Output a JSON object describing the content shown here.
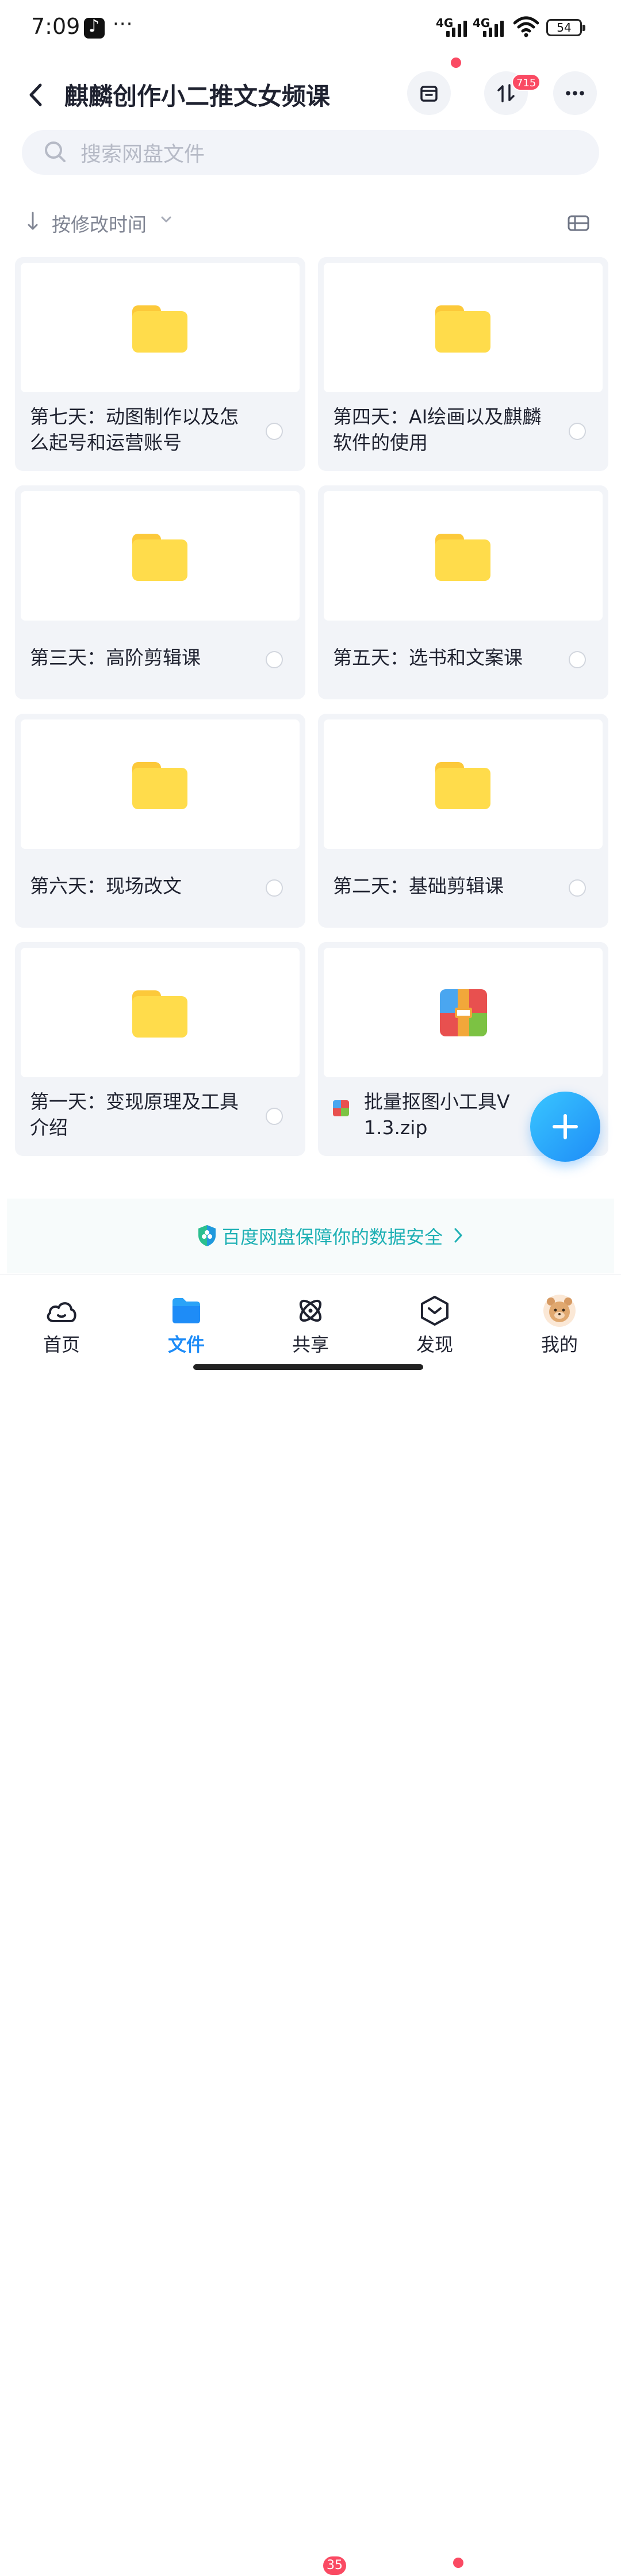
{
  "status_bar": {
    "time": "7:09",
    "signal1_label": "4G",
    "signal2_label": "4G",
    "battery": "54"
  },
  "header": {
    "title": "麒麟创作小二推文女频课",
    "transfer_badge": "715"
  },
  "search": {
    "placeholder": "搜索网盘文件"
  },
  "sort": {
    "label": "按修改时间"
  },
  "files": [
    {
      "name": "第七天：动图制作以及怎么起号和运营账号",
      "type": "folder"
    },
    {
      "name": "第四天：AI绘画以及麒麟软件的使用",
      "type": "folder"
    },
    {
      "name": "第三天：高阶剪辑课",
      "type": "folder"
    },
    {
      "name": "第五天：选书和文案课",
      "type": "folder"
    },
    {
      "name": "第六天：现场改文",
      "type": "folder"
    },
    {
      "name": "第二天：基础剪辑课",
      "type": "folder"
    },
    {
      "name": "第一天：变现原理及工具介绍",
      "type": "folder"
    },
    {
      "name": "批量抠图小工具V1.3.zip",
      "type": "zip"
    }
  ],
  "security_banner": {
    "text": "百度网盘保障你的数据安全"
  },
  "bottom_nav": {
    "items": [
      {
        "label": "首页"
      },
      {
        "label": "文件"
      },
      {
        "label": "共享",
        "badge": "35"
      },
      {
        "label": "发现"
      },
      {
        "label": "我的"
      }
    ]
  },
  "colors": {
    "accent": "#1e8cf7",
    "folder": "#ffdc4b",
    "badge": "#fa4a63",
    "security_text": "#1eb0b4"
  }
}
